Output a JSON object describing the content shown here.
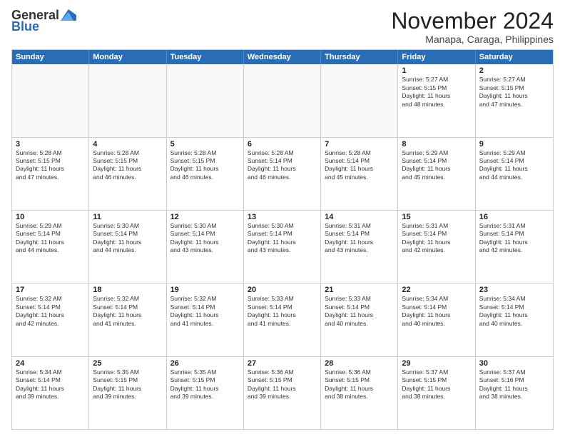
{
  "logo": {
    "general": "General",
    "blue": "Blue"
  },
  "title": "November 2024",
  "subtitle": "Manapa, Caraga, Philippines",
  "days_of_week": [
    "Sunday",
    "Monday",
    "Tuesday",
    "Wednesday",
    "Thursday",
    "Friday",
    "Saturday"
  ],
  "weeks": [
    [
      {
        "day": "",
        "info": "",
        "empty": true
      },
      {
        "day": "",
        "info": "",
        "empty": true
      },
      {
        "day": "",
        "info": "",
        "empty": true
      },
      {
        "day": "",
        "info": "",
        "empty": true
      },
      {
        "day": "",
        "info": "",
        "empty": true
      },
      {
        "day": "1",
        "info": "Sunrise: 5:27 AM\nSunset: 5:15 PM\nDaylight: 11 hours\nand 48 minutes.",
        "empty": false
      },
      {
        "day": "2",
        "info": "Sunrise: 5:27 AM\nSunset: 5:15 PM\nDaylight: 11 hours\nand 47 minutes.",
        "empty": false
      }
    ],
    [
      {
        "day": "3",
        "info": "Sunrise: 5:28 AM\nSunset: 5:15 PM\nDaylight: 11 hours\nand 47 minutes.",
        "empty": false
      },
      {
        "day": "4",
        "info": "Sunrise: 5:28 AM\nSunset: 5:15 PM\nDaylight: 11 hours\nand 46 minutes.",
        "empty": false
      },
      {
        "day": "5",
        "info": "Sunrise: 5:28 AM\nSunset: 5:15 PM\nDaylight: 11 hours\nand 46 minutes.",
        "empty": false
      },
      {
        "day": "6",
        "info": "Sunrise: 5:28 AM\nSunset: 5:14 PM\nDaylight: 11 hours\nand 46 minutes.",
        "empty": false
      },
      {
        "day": "7",
        "info": "Sunrise: 5:28 AM\nSunset: 5:14 PM\nDaylight: 11 hours\nand 45 minutes.",
        "empty": false
      },
      {
        "day": "8",
        "info": "Sunrise: 5:29 AM\nSunset: 5:14 PM\nDaylight: 11 hours\nand 45 minutes.",
        "empty": false
      },
      {
        "day": "9",
        "info": "Sunrise: 5:29 AM\nSunset: 5:14 PM\nDaylight: 11 hours\nand 44 minutes.",
        "empty": false
      }
    ],
    [
      {
        "day": "10",
        "info": "Sunrise: 5:29 AM\nSunset: 5:14 PM\nDaylight: 11 hours\nand 44 minutes.",
        "empty": false
      },
      {
        "day": "11",
        "info": "Sunrise: 5:30 AM\nSunset: 5:14 PM\nDaylight: 11 hours\nand 44 minutes.",
        "empty": false
      },
      {
        "day": "12",
        "info": "Sunrise: 5:30 AM\nSunset: 5:14 PM\nDaylight: 11 hours\nand 43 minutes.",
        "empty": false
      },
      {
        "day": "13",
        "info": "Sunrise: 5:30 AM\nSunset: 5:14 PM\nDaylight: 11 hours\nand 43 minutes.",
        "empty": false
      },
      {
        "day": "14",
        "info": "Sunrise: 5:31 AM\nSunset: 5:14 PM\nDaylight: 11 hours\nand 43 minutes.",
        "empty": false
      },
      {
        "day": "15",
        "info": "Sunrise: 5:31 AM\nSunset: 5:14 PM\nDaylight: 11 hours\nand 42 minutes.",
        "empty": false
      },
      {
        "day": "16",
        "info": "Sunrise: 5:31 AM\nSunset: 5:14 PM\nDaylight: 11 hours\nand 42 minutes.",
        "empty": false
      }
    ],
    [
      {
        "day": "17",
        "info": "Sunrise: 5:32 AM\nSunset: 5:14 PM\nDaylight: 11 hours\nand 42 minutes.",
        "empty": false
      },
      {
        "day": "18",
        "info": "Sunrise: 5:32 AM\nSunset: 5:14 PM\nDaylight: 11 hours\nand 41 minutes.",
        "empty": false
      },
      {
        "day": "19",
        "info": "Sunrise: 5:32 AM\nSunset: 5:14 PM\nDaylight: 11 hours\nand 41 minutes.",
        "empty": false
      },
      {
        "day": "20",
        "info": "Sunrise: 5:33 AM\nSunset: 5:14 PM\nDaylight: 11 hours\nand 41 minutes.",
        "empty": false
      },
      {
        "day": "21",
        "info": "Sunrise: 5:33 AM\nSunset: 5:14 PM\nDaylight: 11 hours\nand 40 minutes.",
        "empty": false
      },
      {
        "day": "22",
        "info": "Sunrise: 5:34 AM\nSunset: 5:14 PM\nDaylight: 11 hours\nand 40 minutes.",
        "empty": false
      },
      {
        "day": "23",
        "info": "Sunrise: 5:34 AM\nSunset: 5:14 PM\nDaylight: 11 hours\nand 40 minutes.",
        "empty": false
      }
    ],
    [
      {
        "day": "24",
        "info": "Sunrise: 5:34 AM\nSunset: 5:14 PM\nDaylight: 11 hours\nand 39 minutes.",
        "empty": false
      },
      {
        "day": "25",
        "info": "Sunrise: 5:35 AM\nSunset: 5:15 PM\nDaylight: 11 hours\nand 39 minutes.",
        "empty": false
      },
      {
        "day": "26",
        "info": "Sunrise: 5:35 AM\nSunset: 5:15 PM\nDaylight: 11 hours\nand 39 minutes.",
        "empty": false
      },
      {
        "day": "27",
        "info": "Sunrise: 5:36 AM\nSunset: 5:15 PM\nDaylight: 11 hours\nand 39 minutes.",
        "empty": false
      },
      {
        "day": "28",
        "info": "Sunrise: 5:36 AM\nSunset: 5:15 PM\nDaylight: 11 hours\nand 38 minutes.",
        "empty": false
      },
      {
        "day": "29",
        "info": "Sunrise: 5:37 AM\nSunset: 5:15 PM\nDaylight: 11 hours\nand 38 minutes.",
        "empty": false
      },
      {
        "day": "30",
        "info": "Sunrise: 5:37 AM\nSunset: 5:16 PM\nDaylight: 11 hours\nand 38 minutes.",
        "empty": false
      }
    ]
  ]
}
